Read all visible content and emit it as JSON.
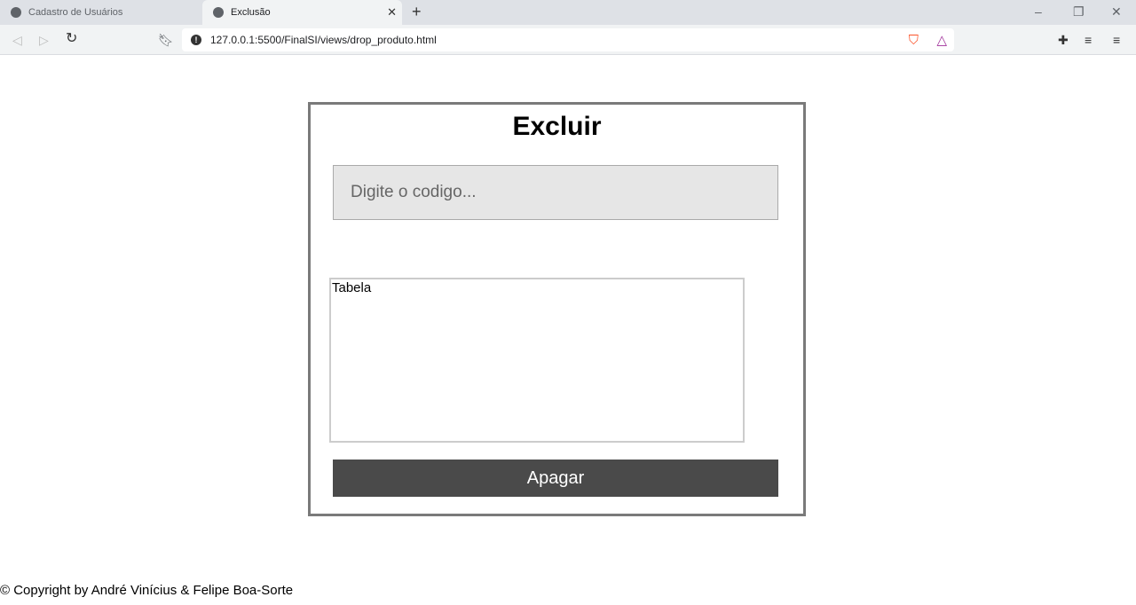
{
  "browser": {
    "tabs": [
      {
        "label": "Cadastro de Usuários"
      },
      {
        "label": "Exclusão"
      }
    ],
    "url": "127.0.0.1:5500/FinalSI/views/drop_produto.html"
  },
  "form": {
    "title": "Excluir",
    "code_placeholder": "Digite o codigo...",
    "table_label": "Tabela",
    "delete_label": "Apagar"
  },
  "footer": {
    "text": "© Copyright by André Vinícius & Felipe Boa-Sorte"
  }
}
